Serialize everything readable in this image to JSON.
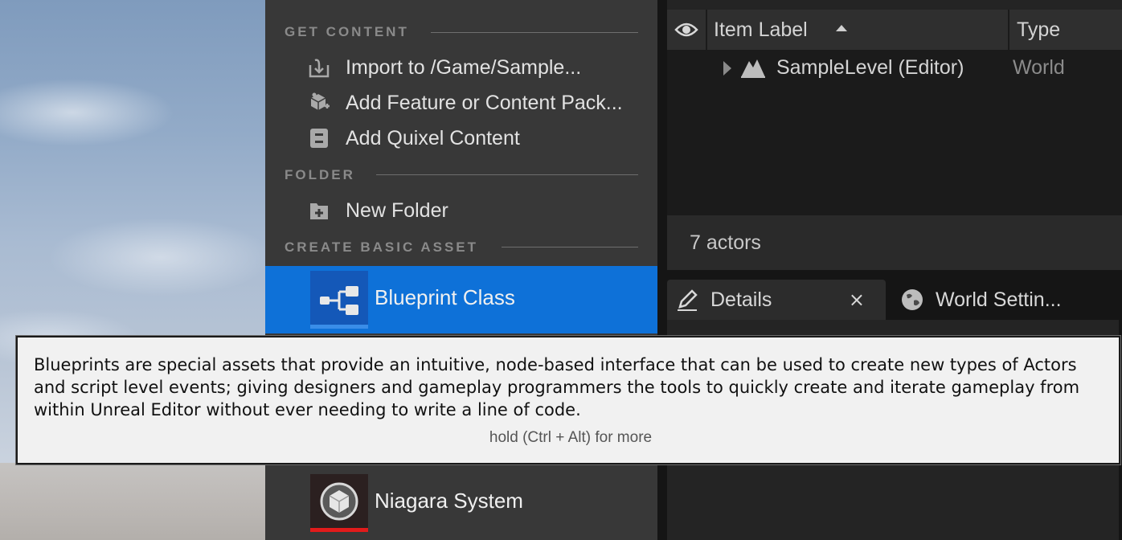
{
  "menu": {
    "sections": {
      "get_content": "GET CONTENT",
      "folder": "FOLDER",
      "create_basic_asset": "CREATE BASIC ASSET"
    },
    "items": {
      "import": "Import to /Game/Sample...",
      "add_feature": "Add Feature or Content Pack...",
      "add_quixel": "Add Quixel Content",
      "new_folder": "New Folder"
    },
    "assets": [
      {
        "label": "Blueprint Class",
        "selected": true,
        "accent": "#2a6fd6"
      },
      {
        "label": "Niagara System",
        "selected": false,
        "accent": "#e21b1b"
      }
    ]
  },
  "outliner": {
    "columns": {
      "label": "Item Label",
      "type": "Type"
    },
    "rows": [
      {
        "label": "SampleLevel (Editor)",
        "type": "World"
      }
    ],
    "status": "7 actors"
  },
  "tabs": [
    {
      "label": "Details",
      "close": "×",
      "icon": "pencil-icon"
    },
    {
      "label": "World Settin...",
      "icon": "globe-icon"
    }
  ],
  "tooltip": {
    "description": "Blueprints are special assets that provide an intuitive, node-based interface that can be used to create new types of Actors and script level events; giving designers and gameplay programmers the tools to quickly create and iterate gameplay from within Unreal Editor without ever needing to write a line of code.",
    "hint": "hold (Ctrl + Alt) for more"
  },
  "colors": {
    "selection": "#0e71d8",
    "menu_bg": "#383838",
    "tooltip_bg": "#f1f1f1"
  }
}
